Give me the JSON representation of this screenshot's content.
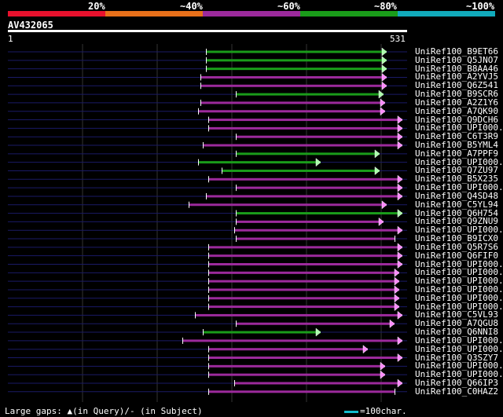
{
  "legend": {
    "percents": [
      "20%",
      "~40%",
      "~60%",
      "~80%",
      "~100%"
    ],
    "colors": [
      "#e8112d",
      "#e8701a",
      "#9c2a9c",
      "#1a9c1a",
      "#11aabb"
    ]
  },
  "query": {
    "name": "AV432065",
    "start": "1",
    "end": "531"
  },
  "footer": {
    "gaps_text": "Large gaps: ▲(in Query)/- (in Subject)",
    "scale_text": "=100char."
  },
  "hits": [
    {
      "label": "UniRef100_B9ET66",
      "color": "green",
      "start": 262,
      "end": 492,
      "arrow": true
    },
    {
      "label": "UniRef100_Q5JNO7",
      "color": "green",
      "start": 262,
      "end": 492,
      "arrow": true
    },
    {
      "label": "UniRef100_B8AA46",
      "color": "green",
      "start": 262,
      "end": 492,
      "arrow": true
    },
    {
      "label": "UniRef100_A2YVJ5",
      "color": "purple",
      "start": 255,
      "end": 492,
      "arrow": true
    },
    {
      "label": "UniRef100_Q6Z541",
      "color": "purple",
      "start": 255,
      "end": 492,
      "arrow": true
    },
    {
      "label": "UniRef100_B9SCR6",
      "color": "green",
      "start": 300,
      "end": 488,
      "arrow": true
    },
    {
      "label": "UniRef100_A2Z1Y6",
      "color": "purple",
      "start": 255,
      "end": 490,
      "arrow": true
    },
    {
      "label": "UniRef100_A7QK90",
      "color": "purple",
      "start": 252,
      "end": 490,
      "arrow": true
    },
    {
      "label": "UniRef100_Q9DCH6",
      "color": "purple",
      "start": 265,
      "end": 512,
      "arrow": true
    },
    {
      "label": "UniRef100_UPI000..",
      "color": "purple",
      "start": 265,
      "end": 512,
      "arrow": true
    },
    {
      "label": "UniRef100_C6T3R9",
      "color": "purple",
      "start": 300,
      "end": 512,
      "arrow": true
    },
    {
      "label": "UniRef100_B5YML4",
      "color": "purple",
      "start": 258,
      "end": 512,
      "arrow": true
    },
    {
      "label": "UniRef100_A7PPF9",
      "color": "green",
      "start": 300,
      "end": 483,
      "arrow": true
    },
    {
      "label": "UniRef100_UPI000..",
      "color": "green",
      "start": 252,
      "end": 408,
      "arrow": true
    },
    {
      "label": "UniRef100_Q7ZU97",
      "color": "green",
      "start": 282,
      "end": 483,
      "arrow": true
    },
    {
      "label": "UniRef100_B5X235",
      "color": "purple",
      "start": 265,
      "end": 512,
      "arrow": true
    },
    {
      "label": "UniRef100_UPI000..",
      "color": "purple",
      "start": 300,
      "end": 512,
      "arrow": true
    },
    {
      "label": "UniRef100_Q4SD48",
      "color": "purple",
      "start": 262,
      "end": 512,
      "arrow": true
    },
    {
      "label": "UniRef100_C5YL94",
      "color": "purple",
      "start": 240,
      "end": 492,
      "arrow": true
    },
    {
      "label": "UniRef100_Q6H754",
      "color": "green",
      "start": 300,
      "end": 512,
      "arrow": true
    },
    {
      "label": "UniRef100_Q9ZNU9",
      "color": "purple",
      "start": 300,
      "end": 488,
      "arrow": true
    },
    {
      "label": "UniRef100_UPI000..",
      "color": "purple",
      "start": 298,
      "end": 512,
      "arrow": true
    },
    {
      "label": "UniRef100_B9ICX0",
      "color": "purple",
      "start": 300,
      "end": 502,
      "arrow": false
    },
    {
      "label": "UniRef100_Q5R7S6",
      "color": "purple",
      "start": 265,
      "end": 512,
      "arrow": true
    },
    {
      "label": "UniRef100_Q6FIF0",
      "color": "purple",
      "start": 265,
      "end": 512,
      "arrow": true
    },
    {
      "label": "UniRef100_UPI000..",
      "color": "purple",
      "start": 265,
      "end": 512,
      "arrow": true
    },
    {
      "label": "UniRef100_UPI000..",
      "color": "purple",
      "start": 265,
      "end": 508,
      "arrow": true
    },
    {
      "label": "UniRef100_UPI000..",
      "color": "purple",
      "start": 265,
      "end": 508,
      "arrow": true
    },
    {
      "label": "UniRef100_UPI000..",
      "color": "purple",
      "start": 265,
      "end": 508,
      "arrow": true
    },
    {
      "label": "UniRef100_UPI000..",
      "color": "purple",
      "start": 265,
      "end": 508,
      "arrow": true
    },
    {
      "label": "UniRef100_UPI000..",
      "color": "purple",
      "start": 265,
      "end": 508,
      "arrow": true
    },
    {
      "label": "UniRef100_C5VL93",
      "color": "purple",
      "start": 248,
      "end": 512,
      "arrow": true
    },
    {
      "label": "UniRef100_A7QGU8",
      "color": "purple",
      "start": 300,
      "end": 502,
      "arrow": true
    },
    {
      "label": "UniRef100_Q6NNI8",
      "color": "green",
      "start": 258,
      "end": 408,
      "arrow": true
    },
    {
      "label": "UniRef100_UPI000..",
      "color": "purple",
      "start": 232,
      "end": 512,
      "arrow": true
    },
    {
      "label": "UniRef100_UPI000..",
      "color": "purple",
      "start": 265,
      "end": 468,
      "arrow": true
    },
    {
      "label": "UniRef100_Q3SZY7",
      "color": "purple",
      "start": 265,
      "end": 512,
      "arrow": true
    },
    {
      "label": "UniRef100_UPI000..",
      "color": "purple",
      "start": 265,
      "end": 490,
      "arrow": true
    },
    {
      "label": "UniRef100_UPI000..",
      "color": "purple",
      "start": 265,
      "end": 490,
      "arrow": true
    },
    {
      "label": "UniRef100_Q66IP3",
      "color": "purple",
      "start": 298,
      "end": 512,
      "arrow": true
    },
    {
      "label": "UniRef100_C0HAZ2",
      "color": "purple",
      "start": 265,
      "end": 502,
      "arrow": false
    }
  ]
}
